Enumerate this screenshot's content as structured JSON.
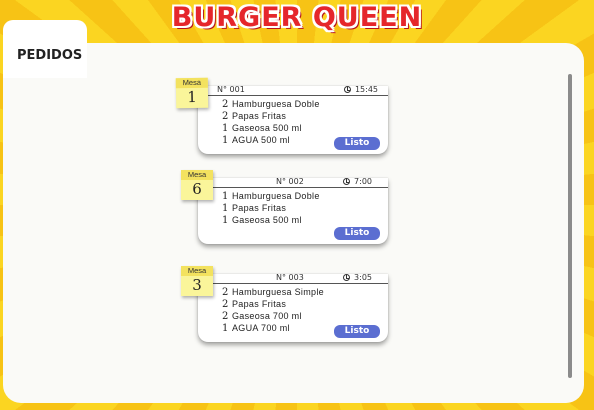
{
  "app": {
    "brand": "BURGER QUEEN"
  },
  "tab": {
    "label": "PEDIDOS"
  },
  "orders": [
    {
      "table_label": "Mesa",
      "table_number": "1",
      "order_number": "N° 001",
      "time": "15:45",
      "items": [
        {
          "qty": "2",
          "name": "Hamburguesa Doble"
        },
        {
          "qty": "2",
          "name": "Papas Fritas"
        },
        {
          "qty": "1",
          "name": "Gaseosa 500 ml"
        },
        {
          "qty": "1",
          "name": "AGUA 500 ml"
        }
      ],
      "button_label": "Listo"
    },
    {
      "table_label": "Mesa",
      "table_number": "6",
      "order_number": "N° 002",
      "time": "7:00",
      "items": [
        {
          "qty": "1",
          "name": "Hamburguesa Doble"
        },
        {
          "qty": "1",
          "name": "Papas Fritas"
        },
        {
          "qty": "1",
          "name": "Gaseosa 500 ml"
        }
      ],
      "button_label": "Listo"
    },
    {
      "table_label": "Mesa",
      "table_number": "3",
      "order_number": "N° 003",
      "time": "3:05",
      "items": [
        {
          "qty": "2",
          "name": "Hamburguesa Simple"
        },
        {
          "qty": "2",
          "name": "Papas Fritas"
        },
        {
          "qty": "2",
          "name": "Gaseosa 700 ml"
        },
        {
          "qty": "1",
          "name": "AGUA 700 ml"
        }
      ],
      "button_label": "Listo"
    }
  ],
  "colors": {
    "brand_red": "#e5262b",
    "accent_blue": "#5b6ed1",
    "note_yellow": "#faf59a",
    "background_yellow": "#f9ca1a"
  },
  "icons": {
    "clock": "clock-icon"
  }
}
